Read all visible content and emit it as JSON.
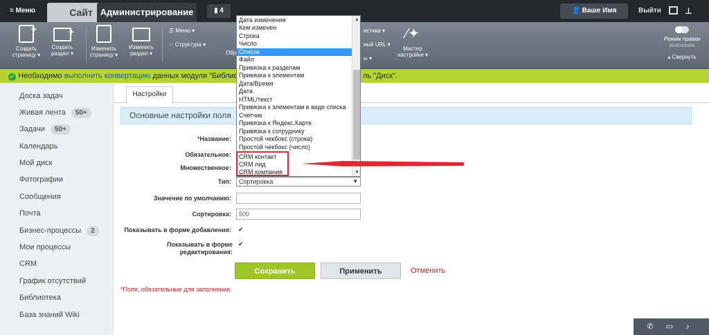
{
  "topbar": {
    "menu_label": "≡ Меню",
    "tab_site": "Сайт",
    "tab_admin": "Администрирование",
    "notify_count": "▮ 4",
    "user_name": "👤 Ваше Имя",
    "logout": "Выйти",
    "pin_icon": "pin-icon"
  },
  "toolbar": {
    "create_page": "Создать страницу ▾",
    "create_section": "Создать раздел ▾",
    "edit_page": "Изменить страницу ▾",
    "edit_section": "Изменить раздел ▾",
    "menu": "☰ Меню ▾",
    "structure": "⁙ Структура ▾",
    "partial_left": "Обр",
    "partial_mid": "истика ▾",
    "partial_url": "ный URL ▾",
    "partial_bottom": "ы ▾",
    "wizard": "Мастер настройки ▾",
    "edit_mode": "Режим правки",
    "edit_mode_state": "выключен",
    "collapse": "▴ Свернуть"
  },
  "notice": {
    "prefix": "Необходимо",
    "link": "выполнить конвертацию",
    "middle": "данных модуля \"Библиотек",
    "suffix": "ль \"Диск\"."
  },
  "sidebar": {
    "items": [
      {
        "label": "Доска задач"
      },
      {
        "label": "Живая лента",
        "badge": "50+"
      },
      {
        "label": "Задачи",
        "badge": "50+"
      },
      {
        "label": "Календарь"
      },
      {
        "label": "Мой диск"
      },
      {
        "label": "Фотографии"
      },
      {
        "label": "Сообщения"
      },
      {
        "label": "Почта"
      },
      {
        "label": "Бизнес-процессы",
        "badge": "2"
      },
      {
        "label": "Мои процессы"
      },
      {
        "label": "CRM"
      },
      {
        "label": "График отсутствий"
      },
      {
        "label": "Библиотека"
      },
      {
        "label": "База знаний Wiki"
      }
    ]
  },
  "main": {
    "tab": "Настройки",
    "section_title": "Основные настройки поля",
    "fields": {
      "name_label": "Название:",
      "required_label": "Обязательное:",
      "multiple_label": "Множественное:",
      "type_label": "Тип:",
      "type_value": "Сортировка",
      "default_label": "Значение по умолчанию:",
      "default_value": "",
      "sort_label": "Сортировка:",
      "sort_value": "500",
      "show_add_label": "Показывать в форме добавления:",
      "show_edit_label": "Показывать в форме редактирования:"
    },
    "dropdown_options": [
      "Дата изменения",
      "Кем изменен",
      "Строка",
      "Число",
      "Список",
      "Файл",
      "Привязка к разделам",
      "Привязка к элементам",
      "Дата/Время",
      "Дата",
      "HTML/текст",
      "Привязка к элементам в виде списка",
      "Счетчик",
      "Привязка к Яндекс.Карте",
      "Привязка к сотруднику",
      "Простой чекбокс (строка)",
      "Простой чекбокс (число)",
      "CRM контакт",
      "CRM лид",
      "CRM компания"
    ],
    "dropdown_selected": "Список",
    "buttons": {
      "save": "Сохранить",
      "apply": "Применить",
      "cancel": "Отменить"
    },
    "required_note": "Поля, обязательные для заполнения."
  },
  "colors": {
    "accent_green": "#9ec624",
    "notice_bg": "#b6d42e",
    "selection_blue": "#3399ff",
    "annotation_red": "#e32633"
  }
}
